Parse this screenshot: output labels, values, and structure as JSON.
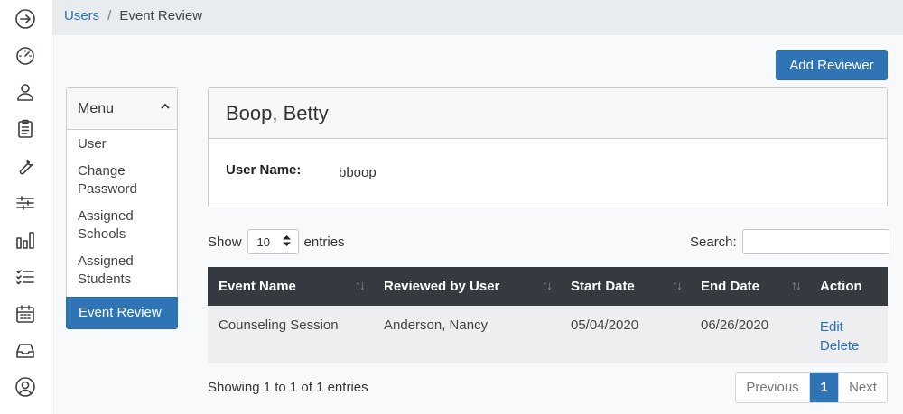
{
  "rail": {
    "icons": [
      "arrow-right-circle-icon",
      "dashboard-gauge-icon",
      "user-icon",
      "clipboard-icon",
      "wrench-icon",
      "sliders-icon",
      "bar-chart-icon",
      "checklist-icon",
      "calendar-icon",
      "inbox-icon",
      "user-circle-icon"
    ]
  },
  "breadcrumb": {
    "parent": "Users",
    "separator": "/",
    "current": "Event Review"
  },
  "actions": {
    "add_reviewer": "Add Reviewer"
  },
  "menu": {
    "title": "Menu",
    "items": [
      {
        "label": "User",
        "active": false
      },
      {
        "label": "Change Password",
        "active": false
      },
      {
        "label": "Assigned Schools",
        "active": false
      },
      {
        "label": "Assigned Students",
        "active": false
      },
      {
        "label": "Event Review",
        "active": true
      }
    ]
  },
  "user_card": {
    "name": "Boop, Betty",
    "username_label": "User Name:",
    "username_value": "bboop"
  },
  "table_controls": {
    "show_label": "Show",
    "entries_value": "10",
    "entries_label": "entries",
    "search_label": "Search:",
    "search_value": ""
  },
  "table": {
    "columns": [
      "Event Name",
      "Reviewed by User",
      "Start Date",
      "End Date",
      "Action"
    ],
    "rows": [
      {
        "event_name": "Counseling Session",
        "reviewed_by": "Anderson, Nancy",
        "start_date": "05/04/2020",
        "end_date": "06/26/2020",
        "actions": [
          "Edit",
          "Delete"
        ]
      }
    ]
  },
  "footer": {
    "info": "Showing 1 to 1 of 1 entries",
    "prev": "Previous",
    "page": "1",
    "next": "Next"
  },
  "colors": {
    "primary": "#2f75b6",
    "table_header": "#343a40",
    "link": "#2a6fb5"
  }
}
